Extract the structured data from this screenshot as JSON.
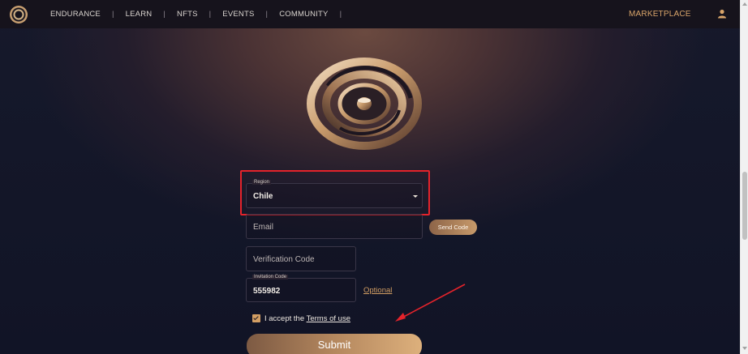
{
  "nav": {
    "items": [
      {
        "label": "ENDURANCE"
      },
      {
        "label": "LEARN"
      },
      {
        "label": "NFTS"
      },
      {
        "label": "EVENTS"
      },
      {
        "label": "COMMUNITY"
      }
    ],
    "separator": "|",
    "marketplace": "MARKETPLACE",
    "user_icon": "user-icon",
    "logo_icon": "ring-logo-icon"
  },
  "form": {
    "region": {
      "label": "Region",
      "value": "Chile"
    },
    "email": {
      "placeholder": "Email"
    },
    "send_code": "Send Code",
    "verification": {
      "placeholder": "Verification Code"
    },
    "invitation": {
      "label": "Invitation Code",
      "value": "555982",
      "optional": "Optional"
    },
    "accept": {
      "prefix": "I accept the ",
      "link": "Terms of use",
      "checked": true
    },
    "submit": "Submit"
  },
  "colors": {
    "accent": "#d39e63",
    "annotation_red": "#e4232b",
    "background": "#111426"
  }
}
